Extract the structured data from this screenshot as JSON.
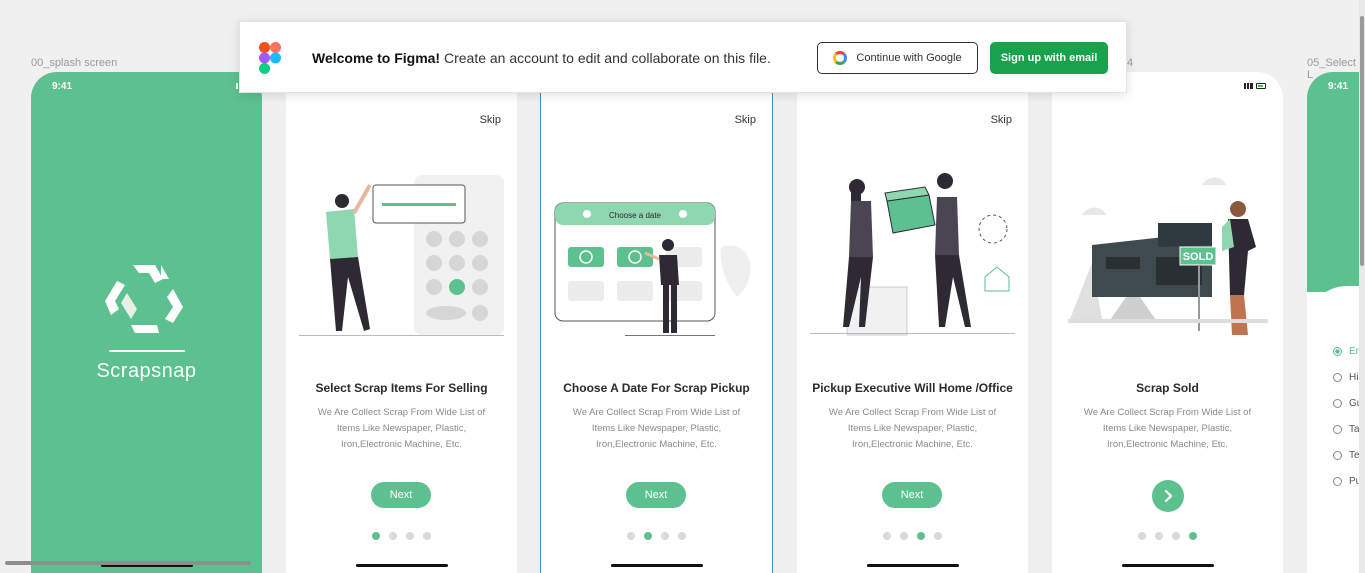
{
  "canvas": {
    "frame_labels": [
      "00_splash screen",
      "4",
      "05_Select L"
    ]
  },
  "banner": {
    "title": "Welcome to Figma!",
    "message": "Create an account to edit and collaborate on this file.",
    "google_button": "Continue with Google",
    "email_button": "Sign up with email"
  },
  "splash": {
    "time": "9:41",
    "app_name": "Scrapsnap"
  },
  "slides": [
    {
      "skip": "Skip",
      "title": "Select Scrap Items For Selling",
      "description": "We Are Collect Scrap From Wide List of Items Like Newspaper, Plastic, Iron,Electronic Machine, Etc.",
      "button": "Next",
      "active_dot": 0
    },
    {
      "skip": "Skip",
      "title": "Choose A Date For Scrap Pickup",
      "description": "We Are Collect Scrap From Wide List of Items Like Newspaper, Plastic, Iron,Electronic Machine, Etc.",
      "button": "Next",
      "illustration_label": "Choose a date",
      "active_dot": 1
    },
    {
      "skip": "Skip",
      "title": "Pickup Executive Will Home /Office",
      "description": "We Are Collect Scrap From Wide List of Items Like Newspaper, Plastic, Iron,Electronic Machine, Etc.",
      "button": "Next",
      "active_dot": 2
    },
    {
      "title": "Scrap Sold",
      "description": "We Are Collect Scrap From Wide List of Items Like Newspaper, Plastic, Iron,Electronic Machine, Etc.",
      "illustration_label": "SOLD",
      "active_dot": 3
    }
  ],
  "language_screen": {
    "time": "9:41",
    "options": [
      "Eng",
      "Hin",
      "Guj",
      "Tam",
      "Telu",
      "Pun"
    ]
  },
  "colors": {
    "brand_green": "#5dc08f",
    "figma_green": "#18a24c"
  }
}
